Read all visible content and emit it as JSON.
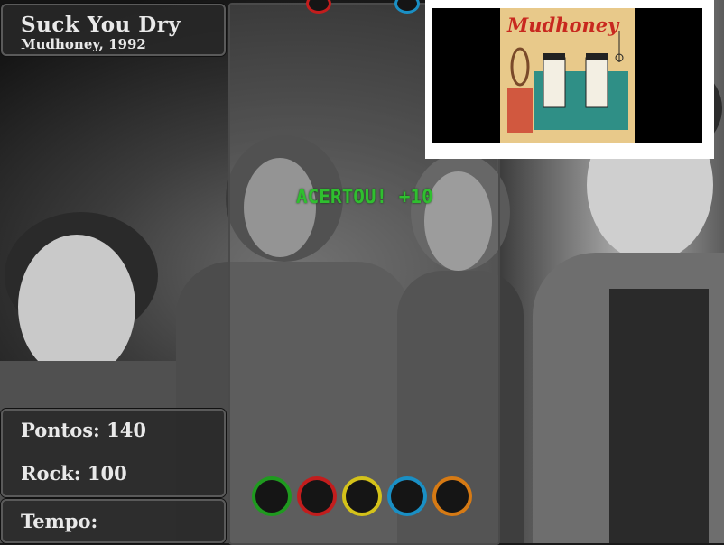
{
  "song": {
    "title": "Suck You Dry",
    "artist_year": "Mudhoney, 1992"
  },
  "score": {
    "points_label": "Pontos: 140",
    "rock_label": "Rock: 100"
  },
  "timer": {
    "label": "Tempo:"
  },
  "feedback": {
    "text": "ACERTOU! +10"
  },
  "album_cover": {
    "logo_text": "Mudhoney",
    "background_color": "#e8c98a",
    "accent_color": "#c8281f",
    "panel_color": "#2f8f86"
  },
  "targets": [
    {
      "color_name": "green",
      "color": "#1f9a1f"
    },
    {
      "color_name": "red",
      "color": "#c21d1d"
    },
    {
      "color_name": "yellow",
      "color": "#d4c21a"
    },
    {
      "color_name": "blue",
      "color": "#1a8fc4"
    },
    {
      "color_name": "orange",
      "color": "#d67a14"
    }
  ],
  "colors": {
    "panel_bg": "#282828",
    "text": "#e9e9e9",
    "feedback_text": "#2fbf2f"
  }
}
